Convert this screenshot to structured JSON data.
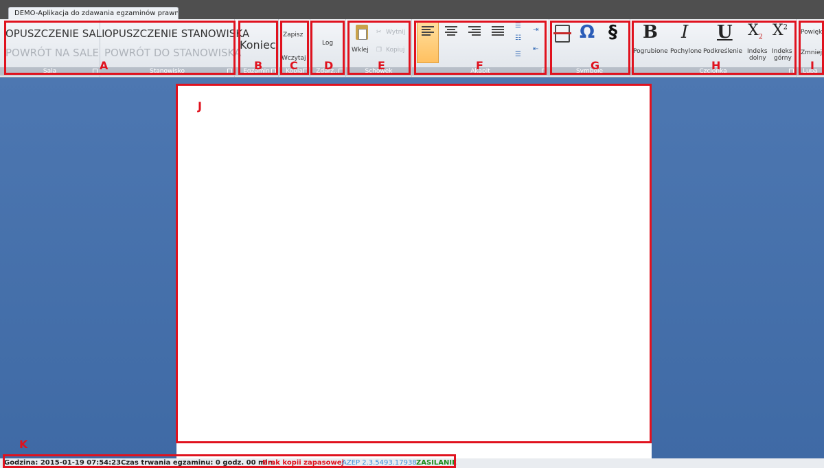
{
  "window": {
    "tab_title": "DEMO-Aplikacja do zdawania egzaminów prawniczych"
  },
  "ribbon": {
    "sala": {
      "top_label": "OPUSZCZENIE SALI",
      "bottom_label": "POWRÓT NA SALE",
      "group_label": "Sala"
    },
    "stanowisko": {
      "top_label": "OPUSZCZENIE STANOWISKA",
      "bottom_label": "POWRÓT DO STANOWISKA",
      "group_label": "Stanowisko"
    },
    "egzamin": {
      "button_label": "Koniec",
      "group_label": "Egzamin"
    },
    "kopia": {
      "save_label": "Zapisz",
      "load_label": "Wczytaj",
      "group_label": "Kopia"
    },
    "zdarzenia": {
      "button_label": "Log",
      "group_label": "Zdarz..."
    },
    "schowek": {
      "paste_label": "Wklej",
      "cut_label": "Wytnij",
      "copy_label": "Kopiuj",
      "group_label": "Schowek"
    },
    "akapit": {
      "group_label": "Akapit"
    },
    "symbole": {
      "omega_glyph": "Ω",
      "section_glyph": "§",
      "group_label": "Symbole"
    },
    "czcionka": {
      "bold_glyph": "B",
      "bold_label": "Pogrubione",
      "italic_glyph": "I",
      "italic_label": "Pochylone",
      "underline_glyph": "U",
      "underline_label": "Podkreślenie",
      "sub_glyph": "X",
      "sub_mark": "2",
      "sub_label_1": "Indeks",
      "sub_label_2": "dolny",
      "sup_glyph": "X",
      "sup_mark": "2",
      "sup_label_1": "Indeks",
      "sup_label_2": "górny",
      "group_label": "Czcionka"
    },
    "lupa": {
      "zoom_in_label": "Powięks",
      "zoom_out_label": "Zmniejsz",
      "group_label": "Lupa"
    }
  },
  "annotations": {
    "A": "A",
    "B": "B",
    "C": "C",
    "D": "D",
    "E": "E",
    "F": "F",
    "G": "G",
    "H": "H",
    "I": "I",
    "J": "J",
    "K": "K"
  },
  "status": {
    "time": "Godzina: 2015-01-19 07:54:23",
    "duration": "Czas trwania egzaminu: 0 godz. 00 min.",
    "backup": "Brak kopii zapasowej",
    "version": "AZEP 2.3.5493.17938",
    "power": "ZASILANIE"
  },
  "colors": {
    "annotation": "#e0121e",
    "backup_status": "#e0121e",
    "version_status": "#3a8fd8",
    "power_status": "#1a8a1a",
    "workspace": "#4a73ad"
  }
}
